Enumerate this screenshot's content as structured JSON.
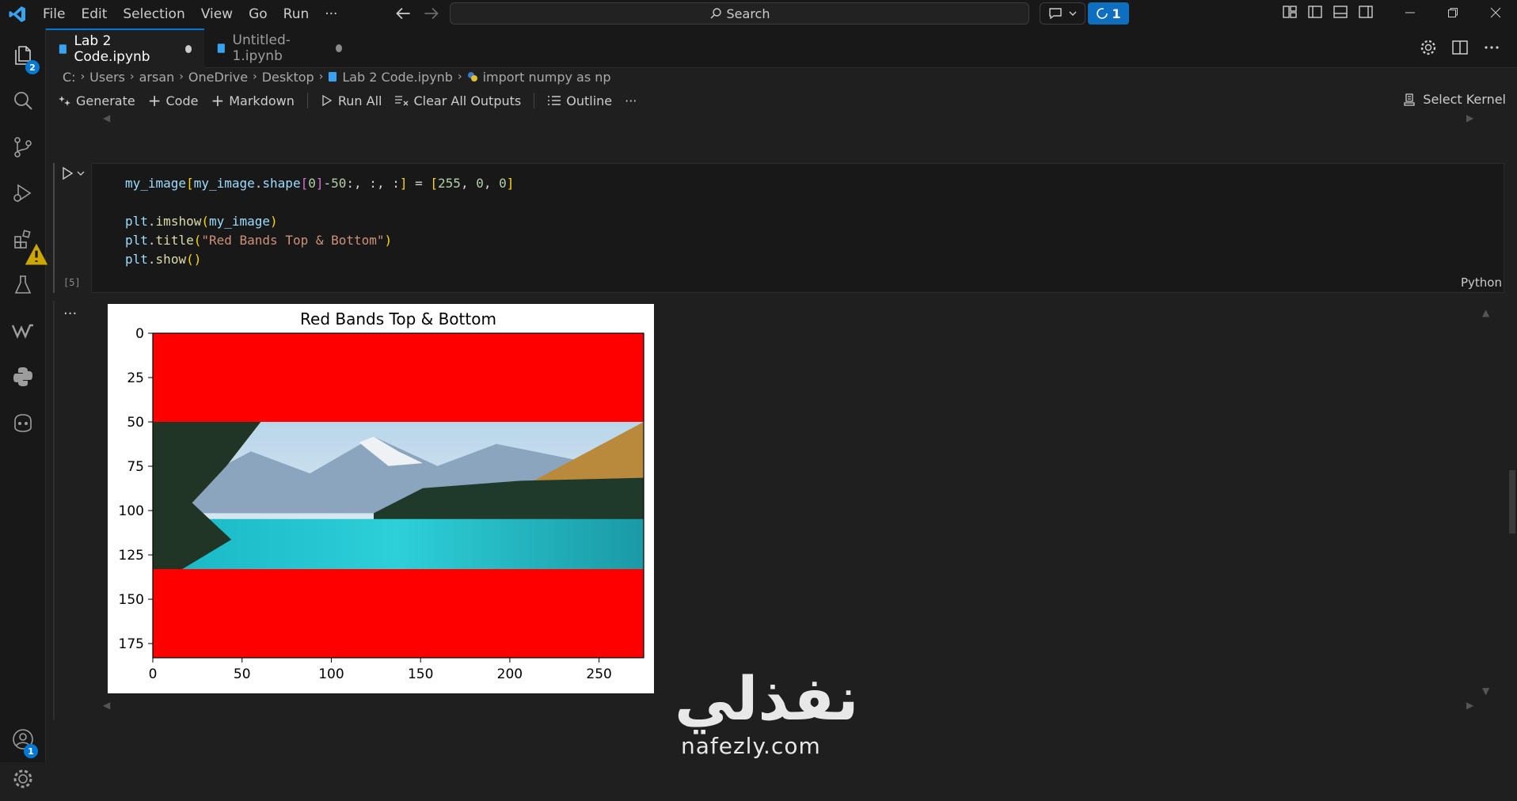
{
  "menu": [
    "File",
    "Edit",
    "Selection",
    "View",
    "Go",
    "Run",
    "···"
  ],
  "search": {
    "label": "Search"
  },
  "copilot": {
    "count": "1"
  },
  "activity": {
    "explorer_badge": "2",
    "accounts_badge": "1"
  },
  "tabs": [
    {
      "label": "Lab 2 Code.ipynb",
      "active": true
    },
    {
      "label": "Untitled-1.ipynb",
      "active": false
    }
  ],
  "breadcrumb": [
    "C:",
    "Users",
    "arsan",
    "OneDrive",
    "Desktop",
    "Lab 2 Code.ipynb",
    "import numpy as np"
  ],
  "toolbar": {
    "generate": "Generate",
    "code": "Code",
    "markdown": "Markdown",
    "run_all": "Run All",
    "clear_outputs": "Clear All Outputs",
    "outline": "Outline",
    "more": "···",
    "kernel": "Select Kernel"
  },
  "cell": {
    "exec_count": "[5]",
    "language": "Python",
    "lines": [
      "my_image[my_image.shape[0]-50:, :, :] = [255, 0, 0]",
      "",
      "plt.imshow(my_image)",
      "plt.title(\"Red Bands Top & Bottom\")",
      "plt.show()"
    ]
  },
  "output": {
    "dots": "···"
  },
  "chart_data": {
    "type": "heatmap",
    "title": "Red Bands Top & Bottom",
    "x_ticks": [
      0,
      50,
      100,
      150,
      200,
      250
    ],
    "y_ticks": [
      0,
      25,
      50,
      75,
      100,
      125,
      150,
      175
    ],
    "xlim": [
      0,
      275
    ],
    "ylim": [
      183,
      0
    ],
    "image_height": 183,
    "image_width": 275,
    "red_band_top_rows": [
      0,
      50
    ],
    "red_band_bottom_rows": [
      133,
      183
    ],
    "band_color": "#ff0000"
  },
  "watermark": {
    "arabic": "نفذلي",
    "latin": "nafezly.com"
  }
}
